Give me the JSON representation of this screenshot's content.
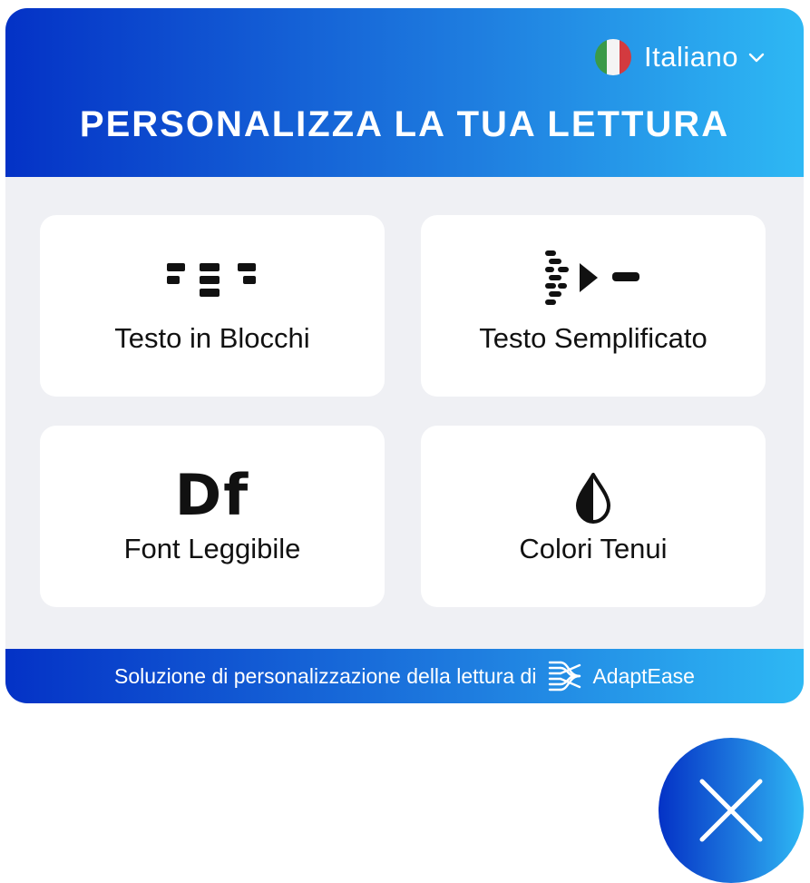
{
  "header": {
    "language": {
      "label": "Italiano",
      "flag_icon": "italy-flag-icon",
      "chevron_icon": "chevron-down-icon"
    },
    "title": "PERSONALIZZA LA TUA LETTURA"
  },
  "options": [
    {
      "label": "Testo in Blocchi",
      "icon": "blocks-icon"
    },
    {
      "label": "Testo Semplificato",
      "icon": "simplify-icon"
    },
    {
      "label": "Font Leggibile",
      "icon": "df-font-icon",
      "icon_text": "Df"
    },
    {
      "label": "Colori Tenui",
      "icon": "droplet-icon"
    }
  ],
  "footer": {
    "text": "Soluzione di personalizzazione della lettura di",
    "brand": "AdaptEase",
    "brand_icon": "adaptease-logo-icon"
  },
  "close_button": {
    "icon": "close-icon"
  },
  "colors": {
    "gradient_start": "#0432c6",
    "gradient_end": "#2eb8f4",
    "panel_bg": "#eff0f4",
    "card_bg": "#ffffff"
  }
}
